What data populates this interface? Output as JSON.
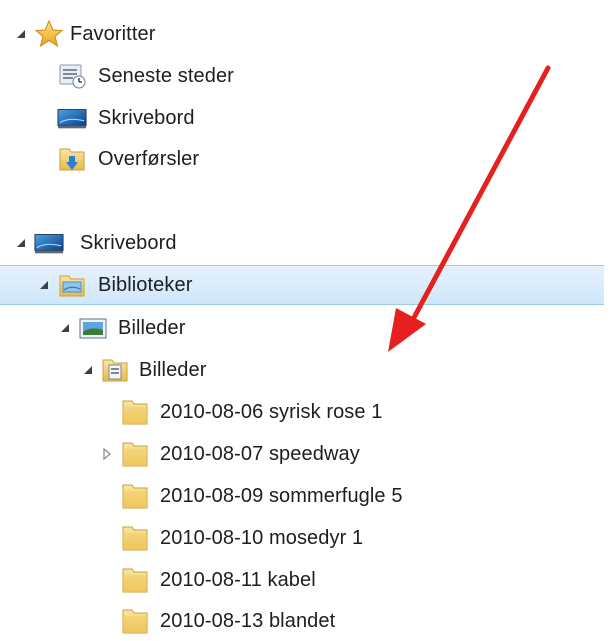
{
  "navigation": {
    "favorites": {
      "label": "Favoritter",
      "icon": "star-icon",
      "items": [
        {
          "label": "Seneste steder",
          "icon": "recent-places-icon"
        },
        {
          "label": "Skrivebord",
          "icon": "desktop-icon"
        },
        {
          "label": "Overførsler",
          "icon": "downloads-folder-icon"
        }
      ]
    },
    "desktop": {
      "label": "Skrivebord",
      "icon": "desktop-icon",
      "libraries": {
        "label": "Biblioteker",
        "icon": "libraries-icon",
        "selected": true,
        "pictures_library": {
          "label": "Billeder",
          "icon": "pictures-library-icon",
          "pictures_folder": {
            "label": "Billeder",
            "icon": "pictures-folder-icon",
            "folders": [
              {
                "label": "2010-08-06 syrisk rose 1",
                "icon": "folder-icon",
                "has_children": false
              },
              {
                "label": "2010-08-07 speedway",
                "icon": "folder-icon",
                "has_children": true
              },
              {
                "label": "2010-08-09 sommerfugle 5",
                "icon": "folder-icon",
                "has_children": false
              },
              {
                "label": "2010-08-10 mosedyr 1",
                "icon": "folder-icon",
                "has_children": false
              },
              {
                "label": "2010-08-11 kabel",
                "icon": "folder-icon",
                "has_children": false
              },
              {
                "label": "2010-08-13 blandet",
                "icon": "folder-icon",
                "has_children": false
              }
            ]
          }
        }
      }
    }
  },
  "colors": {
    "selection_background": "#cfe6fb",
    "selection_border": "#9ccbf2",
    "annotation_arrow": "#e5201f",
    "folder_yellow": "#f2cf6a"
  }
}
